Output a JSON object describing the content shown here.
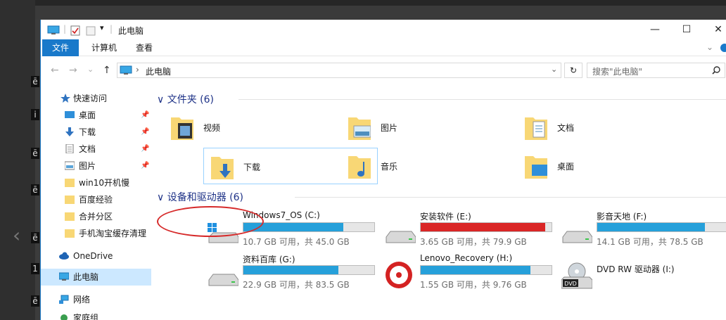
{
  "window": {
    "title": "此电脑",
    "minimize": "—",
    "maximize": "☐",
    "close": "✕"
  },
  "ribbon": {
    "tabs": [
      {
        "label": "文件"
      },
      {
        "label": "计算机"
      },
      {
        "label": "查看"
      }
    ],
    "expand": "⌄"
  },
  "address": {
    "path": "此电脑",
    "separator": "›",
    "refresh": "↻",
    "search_placeholder": "搜索\"此电脑\""
  },
  "sidebar": {
    "items": [
      {
        "label": "快速访问",
        "icon": "star-icon"
      },
      {
        "label": "桌面",
        "icon": "desktop-icon",
        "pinned": true
      },
      {
        "label": "下载",
        "icon": "download-icon",
        "pinned": true
      },
      {
        "label": "文档",
        "icon": "document-icon",
        "pinned": true
      },
      {
        "label": "图片",
        "icon": "picture-icon",
        "pinned": true
      },
      {
        "label": "win10开机慢",
        "icon": "folder-icon"
      },
      {
        "label": "百度经验",
        "icon": "folder-icon"
      },
      {
        "label": "合并分区",
        "icon": "folder-icon"
      },
      {
        "label": "手机淘宝缓存清理",
        "icon": "folder-icon"
      },
      {
        "label": "OneDrive",
        "icon": "cloud-icon"
      },
      {
        "label": "此电脑",
        "icon": "computer-icon",
        "selected": true
      },
      {
        "label": "网络",
        "icon": "network-icon"
      },
      {
        "label": "家庭组",
        "icon": "homegroup-icon"
      }
    ]
  },
  "folders": {
    "header": "文件夹 (6)",
    "items": [
      {
        "label": "视频",
        "icon": "video-folder-icon"
      },
      {
        "label": "图片",
        "icon": "picture-folder-icon"
      },
      {
        "label": "文档",
        "icon": "document-folder-icon"
      },
      {
        "label": "下载",
        "icon": "download-folder-icon",
        "selected": true
      },
      {
        "label": "音乐",
        "icon": "music-folder-icon"
      },
      {
        "label": "桌面",
        "icon": "desktop-folder-icon"
      }
    ]
  },
  "drives": {
    "header": "设备和驱动器 (6)",
    "items": [
      {
        "name": "Windows7_OS (C:)",
        "free": "10.7 GB 可用，共 45.0 GB",
        "used_fraction": 0.762,
        "icon": "windows-drive-icon"
      },
      {
        "name": "安装软件 (E:)",
        "free": "3.65 GB 可用，共 79.9 GB",
        "used_fraction": 0.954,
        "full": true,
        "icon": "hard-drive-icon"
      },
      {
        "name": "影音天地 (F:)",
        "free": "14.1 GB 可用，共 78.5 GB",
        "used_fraction": 0.82,
        "icon": "hard-drive-icon"
      },
      {
        "name": "资料百库 (G:)",
        "free": "22.9 GB 可用，共 83.5 GB",
        "used_fraction": 0.726,
        "icon": "hard-drive-icon"
      },
      {
        "name": "Lenovo_Recovery (H:)",
        "free": "1.55 GB 可用，共 9.76 GB",
        "used_fraction": 0.841,
        "icon": "recovery-drive-icon"
      },
      {
        "name": "DVD RW 驱动器 (I:)",
        "free": "",
        "icon": "dvd-drive-icon"
      }
    ]
  },
  "desktop": {
    "glyphs": [
      "ē",
      "i",
      "ē",
      "ē",
      "ē",
      "1",
      "ē"
    ]
  },
  "colors": {
    "accent": "#1979ca",
    "bar": "#26a0da",
    "bar_full": "#da2626",
    "annotation": "#d62a2a"
  }
}
